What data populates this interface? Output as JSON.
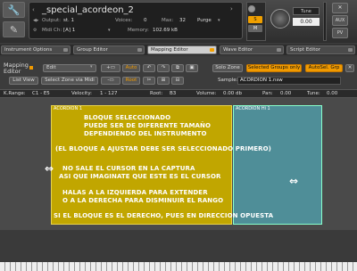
{
  "header": {
    "instrument_name": "_special_acordeon_2",
    "output_label": "Output:",
    "output_value": "st. 1",
    "voices_label": "Voices:",
    "voices_value": "0",
    "max_label": "Max:",
    "max_value": "32",
    "purge_label": "Purge",
    "midi_label": "Midi Ch:",
    "midi_value": "[A]  1",
    "memory_label": "Memory:",
    "memory_value": "102.69 kB",
    "tune_label": "Tune",
    "tune_value": "0.00",
    "s_label": "S",
    "m_label": "M",
    "aux_label": "AUX",
    "pv_label": "PV"
  },
  "tabs": [
    "Instrument Options",
    "Group Editor",
    "Mapping Editor",
    "Wave Editor",
    "Script Editor"
  ],
  "mapping": {
    "title_line1": "Mapping",
    "title_line2": "Editor",
    "edit_label": "Edit",
    "auto_label": "Auto",
    "solo_zone": "Solo Zone",
    "selected_groups_only": "Selected Groups only",
    "autosel_grp": "AutoSel. Grp",
    "list_view": "List View",
    "select_zone_via_midi": "Select Zone via Midi",
    "root_label": "Root",
    "sample_label": "Sample:",
    "sample_value": "ACORDION 1.nsw",
    "krange_label": "K.Range:",
    "krange_value": "C1  -  E5",
    "velocity_label": "Velocity:",
    "velocity_value": "1  -  127",
    "root_key_label": "Root:",
    "root_key_value": "B3",
    "volume_label": "Volume:",
    "volume_value": "0.00  db",
    "pan_label": "Pan:",
    "pan_value": "0.00",
    "tune_label": "Tune:",
    "tune_value": "0.00"
  },
  "zones": {
    "zone_a_label": "ACORDION 1",
    "zone_b_label": "ACORDION Hi 1",
    "zone_a_color": "#c1a600",
    "zone_b_color": "#4f8e98"
  },
  "overlay": {
    "line1": "BLOQUE SELECCIONADO",
    "line2": "PUEDE SER DE DIFERENTE TAMAÑO",
    "line3": "DEPENDIENDO DEL INSTRUMENTO",
    "line4": "(EL BLOQUE A AJUSTAR DEBE SER SELECCIONADO PRIMERO)",
    "line5": "NO SALE EL CURSOR EN LA CAPTURA",
    "line6": "ASI QUE IMAGINATE QUE ESTE ES EL CURSOR",
    "line7": "HALAS A LA IZQUIERDA PARA EXTENDER",
    "line8": "O A LA DERECHA PARA DISMINUIR EL RANGO",
    "line9": "SI EL BLOQUE ES EL DERECHO, PUES EN DIRECCION OPUESTA"
  }
}
